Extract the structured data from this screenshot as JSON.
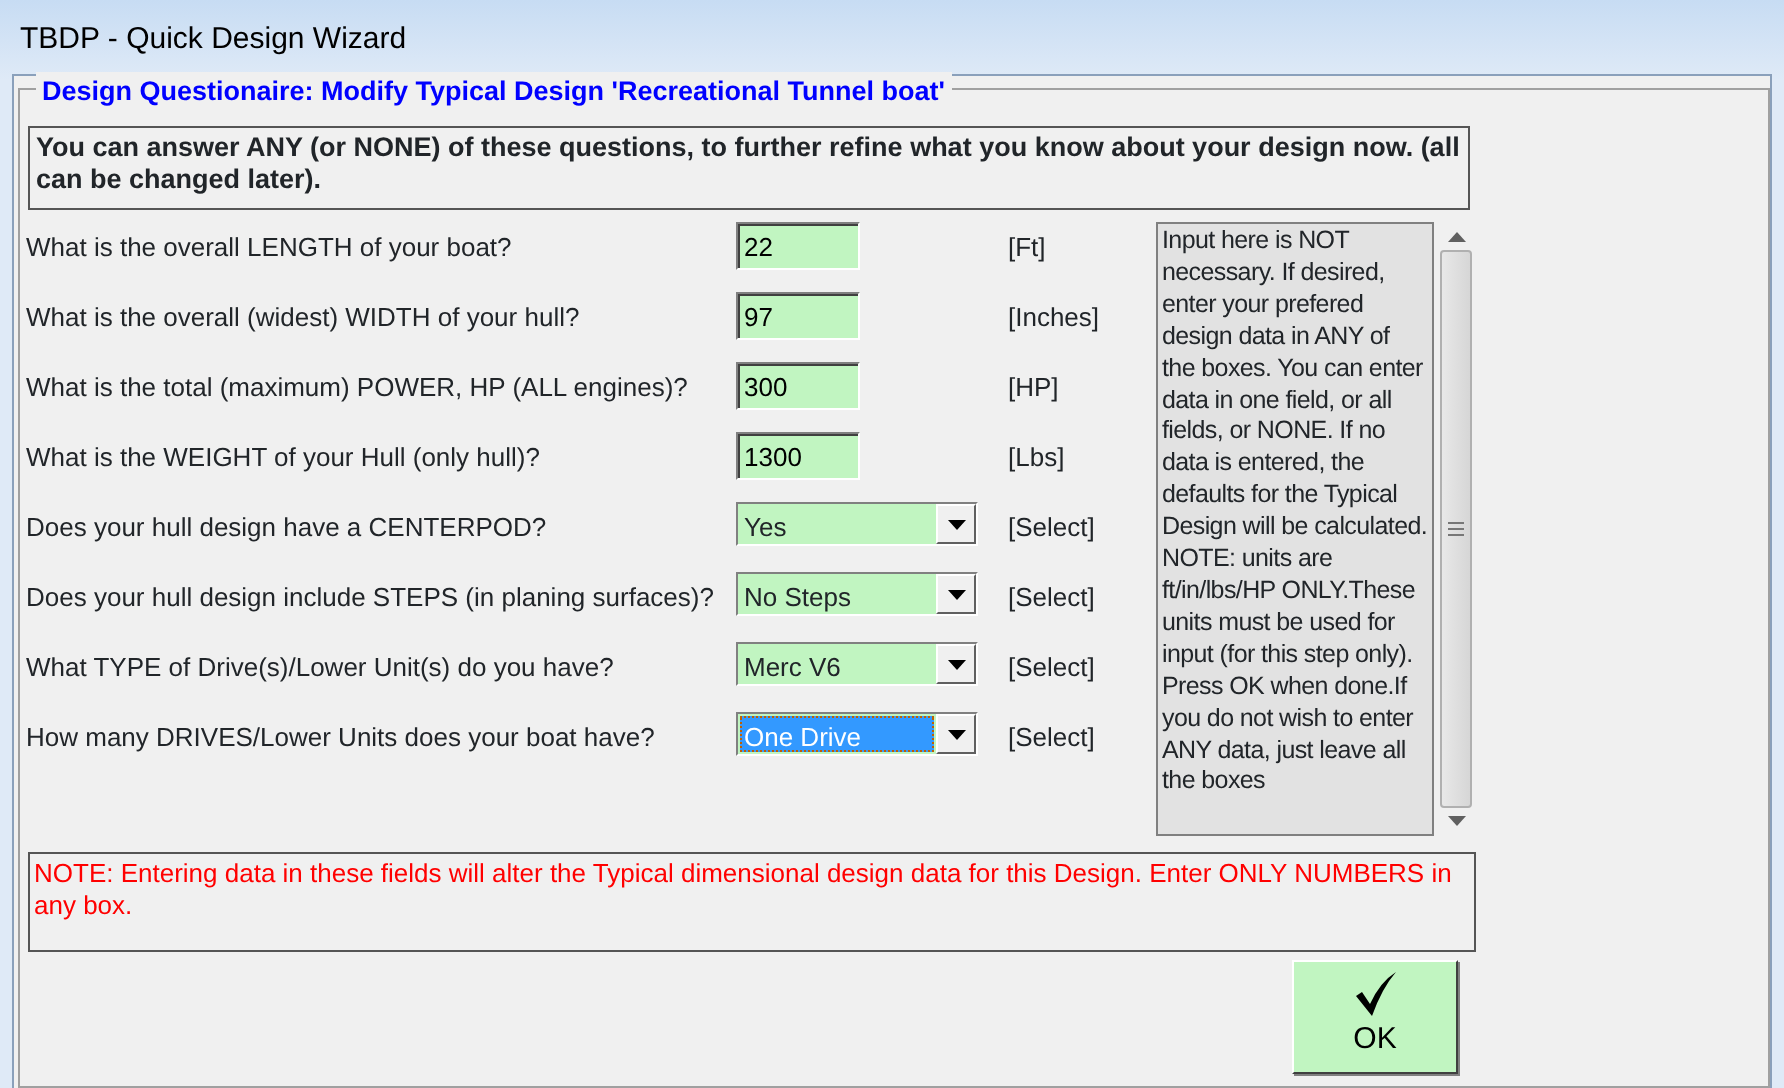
{
  "window": {
    "title": "TBDP - Quick Design Wizard"
  },
  "group": {
    "legend": "Design Questionaire: Modify Typical Design 'Recreational Tunnel boat'"
  },
  "intro": "You can answer ANY (or NONE) of these questions, to further refine what you know about your design now. (all can be changed later).",
  "questions": [
    {
      "kind": "text",
      "label": "What is the overall LENGTH of your boat?",
      "value": "22",
      "unit": "[Ft]",
      "focused": false
    },
    {
      "kind": "text",
      "label": "What is the overall (widest) WIDTH of your hull?",
      "value": "97",
      "unit": "[Inches]",
      "focused": false
    },
    {
      "kind": "text",
      "label": "What is the total (maximum) POWER, HP  (ALL engines)?",
      "value": "300",
      "unit": "[HP]",
      "focused": false
    },
    {
      "kind": "text",
      "label": "What is the WEIGHT of your Hull (only hull)?",
      "value": "1300",
      "unit": "[Lbs]",
      "focused": false
    },
    {
      "kind": "select",
      "label": "Does your hull design have a CENTERPOD?",
      "value": "Yes",
      "unit": "[Select]",
      "focused": false
    },
    {
      "kind": "select",
      "label": "Does your hull design include STEPS (in planing surfaces)?",
      "value": "No Steps",
      "unit": "[Select]",
      "focused": false
    },
    {
      "kind": "select",
      "label": "What TYPE of Drive(s)/Lower Unit(s) do you have?",
      "value": "Merc V6",
      "unit": "[Select]",
      "focused": false
    },
    {
      "kind": "select",
      "label": "How many DRIVES/Lower Units does your boat have?",
      "value": "One Drive",
      "unit": "[Select]",
      "focused": true
    }
  ],
  "help": "Input here is NOT necessary.  If desired, enter your prefered design data in ANY of the boxes.  You can enter data in one field, or all fields, or NONE. If no data is entered, the defaults for the Typical Design will be calculated.  NOTE: units are ft/in/lbs/HP ONLY.These units must be used for input (for this step only). Press OK when done.If you do not wish to enter ANY data, just leave all the boxes",
  "note": "NOTE: Entering data in these fields will alter the Typical dimensional design data for this Design.  Enter ONLY NUMBERS in any box.",
  "ok_button": {
    "label": "OK"
  }
}
